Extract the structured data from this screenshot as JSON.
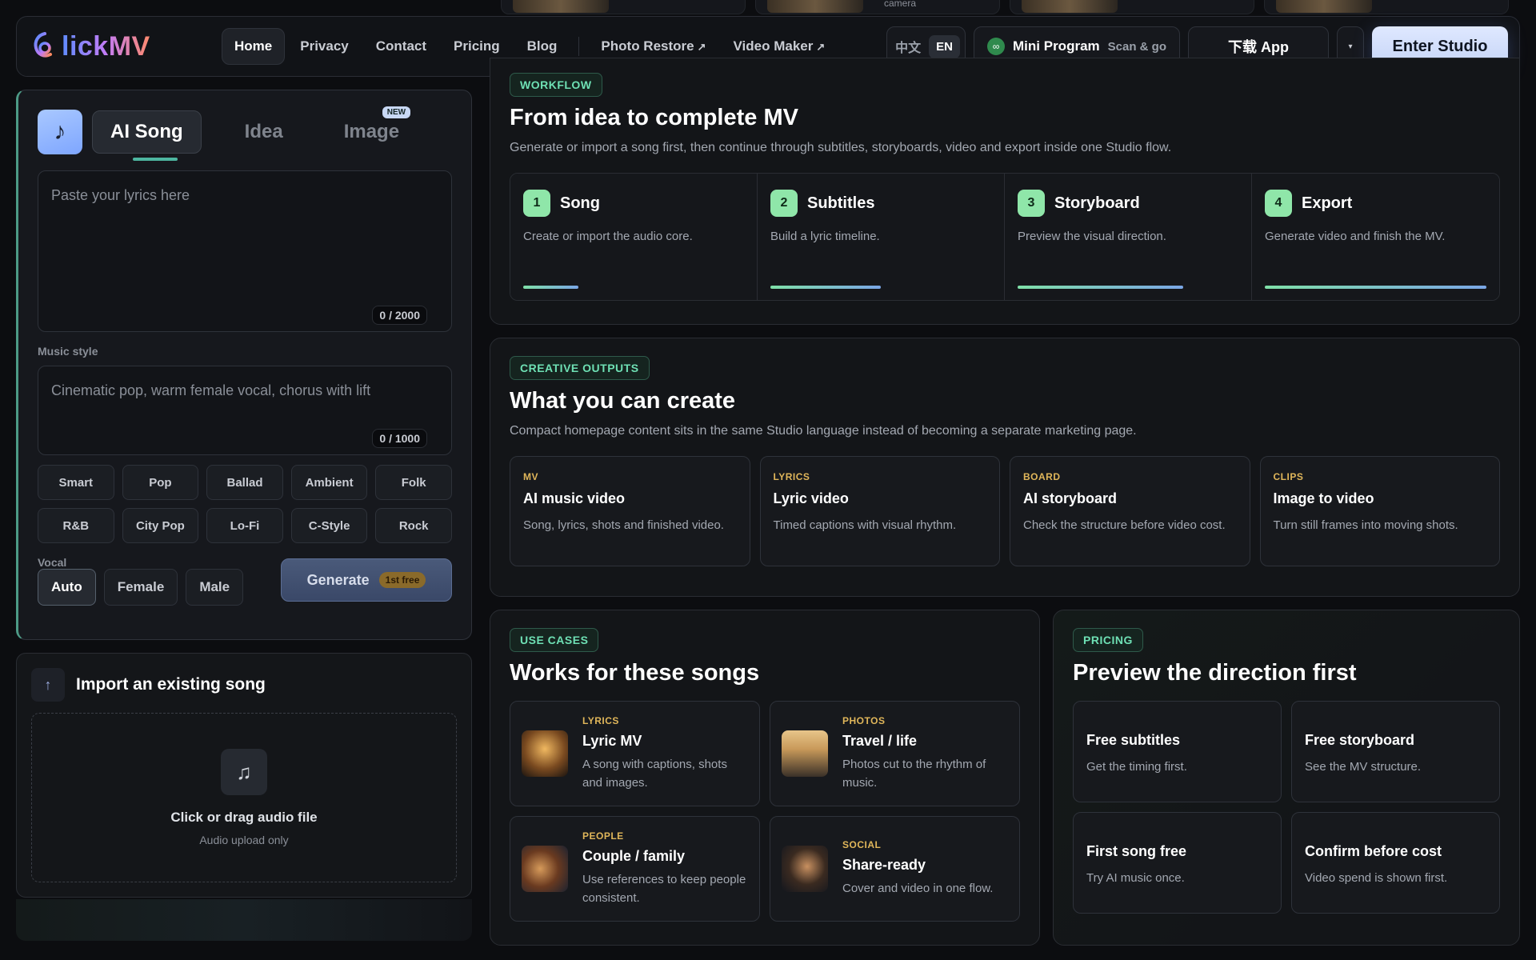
{
  "top_strip": {
    "caption": "camera"
  },
  "header": {
    "logo_text": "lickMV",
    "nav": [
      {
        "label": "Home",
        "active": true
      },
      {
        "label": "Privacy"
      },
      {
        "label": "Contact"
      },
      {
        "label": "Pricing"
      },
      {
        "label": "Blog"
      },
      {
        "label": "Photo Restore",
        "external": true
      },
      {
        "label": "Video Maker",
        "external": true
      }
    ],
    "lang_zh": "中文",
    "lang_en": "EN",
    "mini_program": "Mini Program",
    "mini_program_sub": "Scan & go",
    "download_app": "下载 App",
    "enter_studio": "Enter Studio"
  },
  "generator": {
    "tabs": [
      {
        "label": "AI Song",
        "active": true
      },
      {
        "label": "Idea"
      },
      {
        "label": "Image",
        "badge": "NEW"
      }
    ],
    "lyrics_placeholder": "Paste your lyrics here",
    "lyrics_count": "0 / 2000",
    "music_style_label": "Music style",
    "style_placeholder": "Cinematic pop, warm female vocal, chorus with lift",
    "style_count": "0 / 1000",
    "styles": [
      "Smart",
      "Pop",
      "Ballad",
      "Ambient",
      "Folk",
      "R&B",
      "City Pop",
      "Lo-Fi",
      "C-Style",
      "Rock"
    ],
    "vocal_label": "Vocal",
    "vocals": [
      {
        "label": "Auto",
        "active": true
      },
      {
        "label": "Female"
      },
      {
        "label": "Male"
      }
    ],
    "generate": "Generate",
    "generate_badge": "1st free"
  },
  "import": {
    "title": "Import an existing song",
    "drop_title": "Click or drag audio file",
    "drop_sub": "Audio upload only"
  },
  "workflow": {
    "chip": "WORKFLOW",
    "title": "From idea to complete MV",
    "subtitle": "Generate or import a song first, then continue through subtitles, storyboards, video and export inside one Studio flow.",
    "steps": [
      {
        "num": "1",
        "title": "Song",
        "desc": "Create or import the audio core.",
        "progress": 0.25
      },
      {
        "num": "2",
        "title": "Subtitles",
        "desc": "Build a lyric timeline.",
        "progress": 0.5
      },
      {
        "num": "3",
        "title": "Storyboard",
        "desc": "Preview the visual direction.",
        "progress": 0.75
      },
      {
        "num": "4",
        "title": "Export",
        "desc": "Generate video and finish the MV.",
        "progress": 1.0
      }
    ]
  },
  "outputs": {
    "chip": "CREATIVE OUTPUTS",
    "title": "What you can create",
    "subtitle": "Compact homepage content sits in the same Studio language instead of becoming a separate marketing page.",
    "cards": [
      {
        "tag": "MV",
        "title": "AI music video",
        "desc": "Song, lyrics, shots and finished video."
      },
      {
        "tag": "LYRICS",
        "title": "Lyric video",
        "desc": "Timed captions with visual rhythm."
      },
      {
        "tag": "BOARD",
        "title": "AI storyboard",
        "desc": "Check the structure before video cost."
      },
      {
        "tag": "CLIPS",
        "title": "Image to video",
        "desc": "Turn still frames into moving shots."
      }
    ]
  },
  "use_cases": {
    "chip": "USE CASES",
    "title": "Works for these songs",
    "cards": [
      {
        "tag": "LYRICS",
        "title": "Lyric MV",
        "desc": "A song with captions, shots and images."
      },
      {
        "tag": "PHOTOS",
        "title": "Travel / life",
        "desc": "Photos cut to the rhythm of music."
      },
      {
        "tag": "PEOPLE",
        "title": "Couple / family",
        "desc": "Use references to keep people consistent."
      },
      {
        "tag": "SOCIAL",
        "title": "Share-ready",
        "desc": "Cover and video in one flow."
      }
    ]
  },
  "pricing": {
    "chip": "PRICING",
    "title": "Preview the direction first",
    "cards": [
      {
        "title": "Free subtitles",
        "desc": "Get the timing first."
      },
      {
        "title": "Free storyboard",
        "desc": "See the MV structure."
      },
      {
        "title": "First song free",
        "desc": "Try AI music once."
      },
      {
        "title": "Confirm before cost",
        "desc": "Video spend is shown first."
      }
    ]
  }
}
